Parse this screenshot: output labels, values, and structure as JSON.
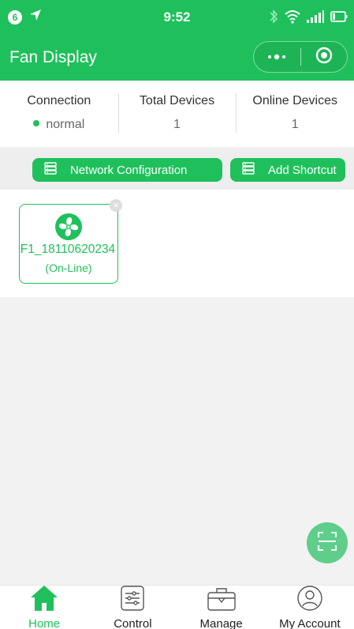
{
  "status_bar": {
    "badge": "6",
    "time": "9:52"
  },
  "header": {
    "title": "Fan Display"
  },
  "stats": {
    "connection_label": "Connection",
    "connection_value": "normal",
    "total_label": "Total Devices",
    "total_value": "1",
    "online_label": "Online Devices",
    "online_value": "1"
  },
  "actions": {
    "network_label": "Network Configuration",
    "shortcut_label": "Add Shortcut"
  },
  "devices": [
    {
      "name": "F1_18110620234",
      "status": "(On-Line)"
    }
  ],
  "tabs": [
    {
      "label": "Home",
      "icon": "home-icon",
      "active": true
    },
    {
      "label": "Control",
      "icon": "sliders-icon",
      "active": false
    },
    {
      "label": "Manage",
      "icon": "briefcase-icon",
      "active": false
    },
    {
      "label": "My Account",
      "icon": "user-icon",
      "active": false
    }
  ],
  "colors": {
    "accent": "#1fc05c",
    "fab": "#5fce8a",
    "page_bg": "#f2f2f2"
  }
}
